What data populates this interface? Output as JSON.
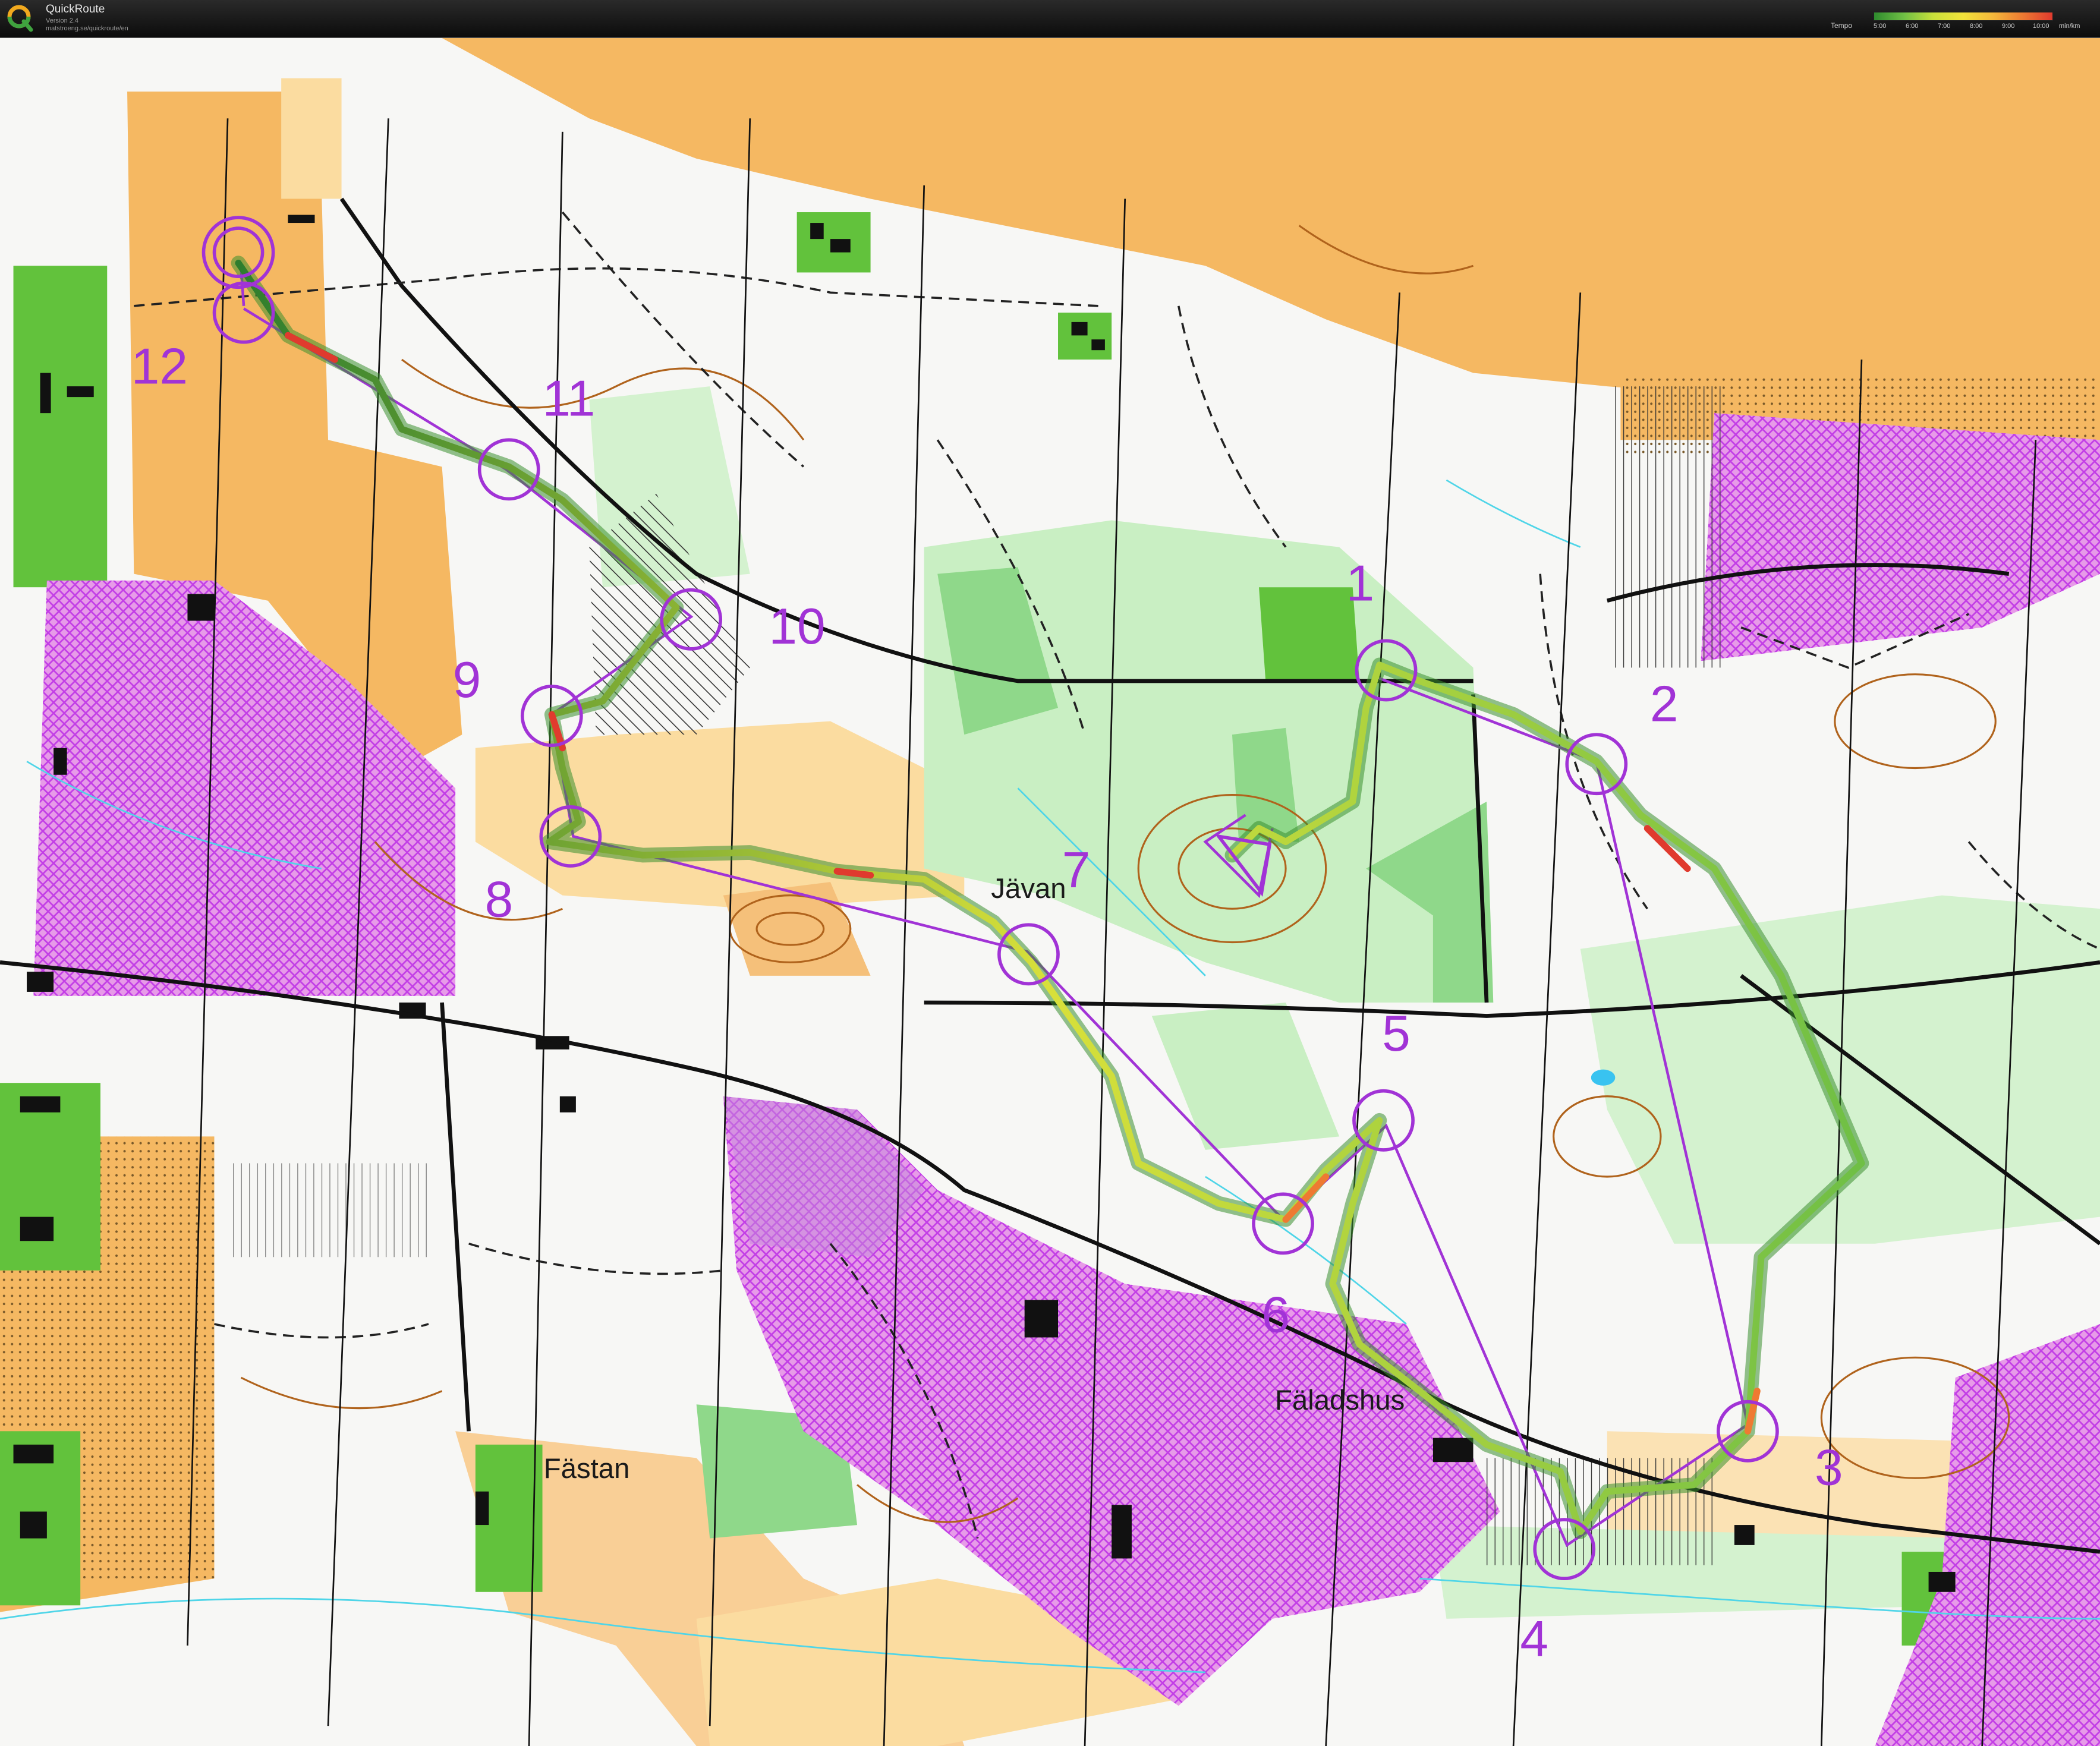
{
  "app": {
    "name": "QuickRoute",
    "version": "Version 2.4",
    "url": "matstroeng.se/quickroute/en"
  },
  "legend": {
    "title": "Tempo",
    "ticks": [
      "5:00",
      "6:00",
      "7:00",
      "8:00",
      "9:00",
      "10:00"
    ],
    "unit": "min/km"
  },
  "map": {
    "controls": [
      "1",
      "2",
      "3",
      "4",
      "5",
      "6",
      "7",
      "8",
      "9",
      "10",
      "11",
      "12"
    ],
    "place_names": [
      "Jävan",
      "Fäladshus",
      "Fästan"
    ],
    "colors": {
      "course": "#a133d6",
      "open_land": "#f5b862",
      "rough_open": "#fbdca0",
      "forest_green": "#8fd88a",
      "light_green": "#c9efc3",
      "private": "#c23ee6",
      "building": "#111111",
      "route_fast": "#2e7d2e",
      "route_slow": "#e03a2e"
    }
  }
}
